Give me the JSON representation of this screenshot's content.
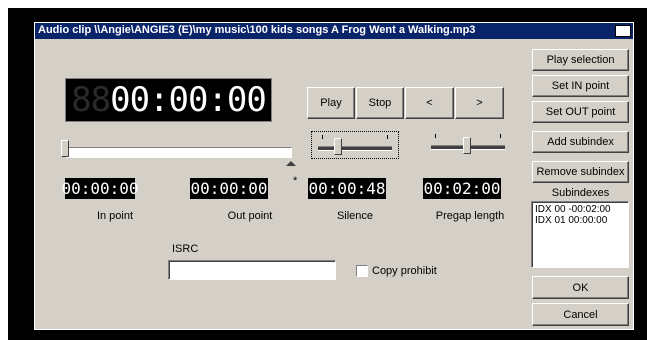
{
  "window": {
    "title": "Audio clip \\\\Angie\\ANGIE3 (E)\\my music\\100 kids songs A Frog Went a Walking.mp3"
  },
  "main_time": {
    "ghost": "88",
    "value": "00:00:00"
  },
  "transport": {
    "play": "Play",
    "stop": "Stop",
    "prev": "<",
    "next": ">"
  },
  "small_times": [
    {
      "name": "in-point",
      "value": "00:00:00",
      "label": "In point"
    },
    {
      "name": "out-point",
      "value": "00:00:00",
      "label": "Out point",
      "marker": "*"
    },
    {
      "name": "silence",
      "value": "00:00:48",
      "label": "Silence"
    },
    {
      "name": "pregap",
      "value": "00:02:00",
      "label": "Pregap length"
    }
  ],
  "isrc": {
    "label": "ISRC",
    "value": ""
  },
  "copy_prohibit": {
    "label": "Copy prohibit",
    "checked": false
  },
  "right_buttons": {
    "play_selection": "Play selection",
    "set_in": "Set IN point",
    "set_out": "Set OUT point",
    "add_subindex": "Add subindex",
    "remove_subindex": "Remove subindex"
  },
  "subindexes": {
    "label": "Subindexes",
    "items": [
      "IDX 00 -00:02:00",
      "IDX 01  00:00:00"
    ]
  },
  "ok": "OK",
  "cancel": "Cancel",
  "colors": {
    "titlebar": "#0a246a",
    "face": "#d4d0c8",
    "lcd": "#000000"
  }
}
